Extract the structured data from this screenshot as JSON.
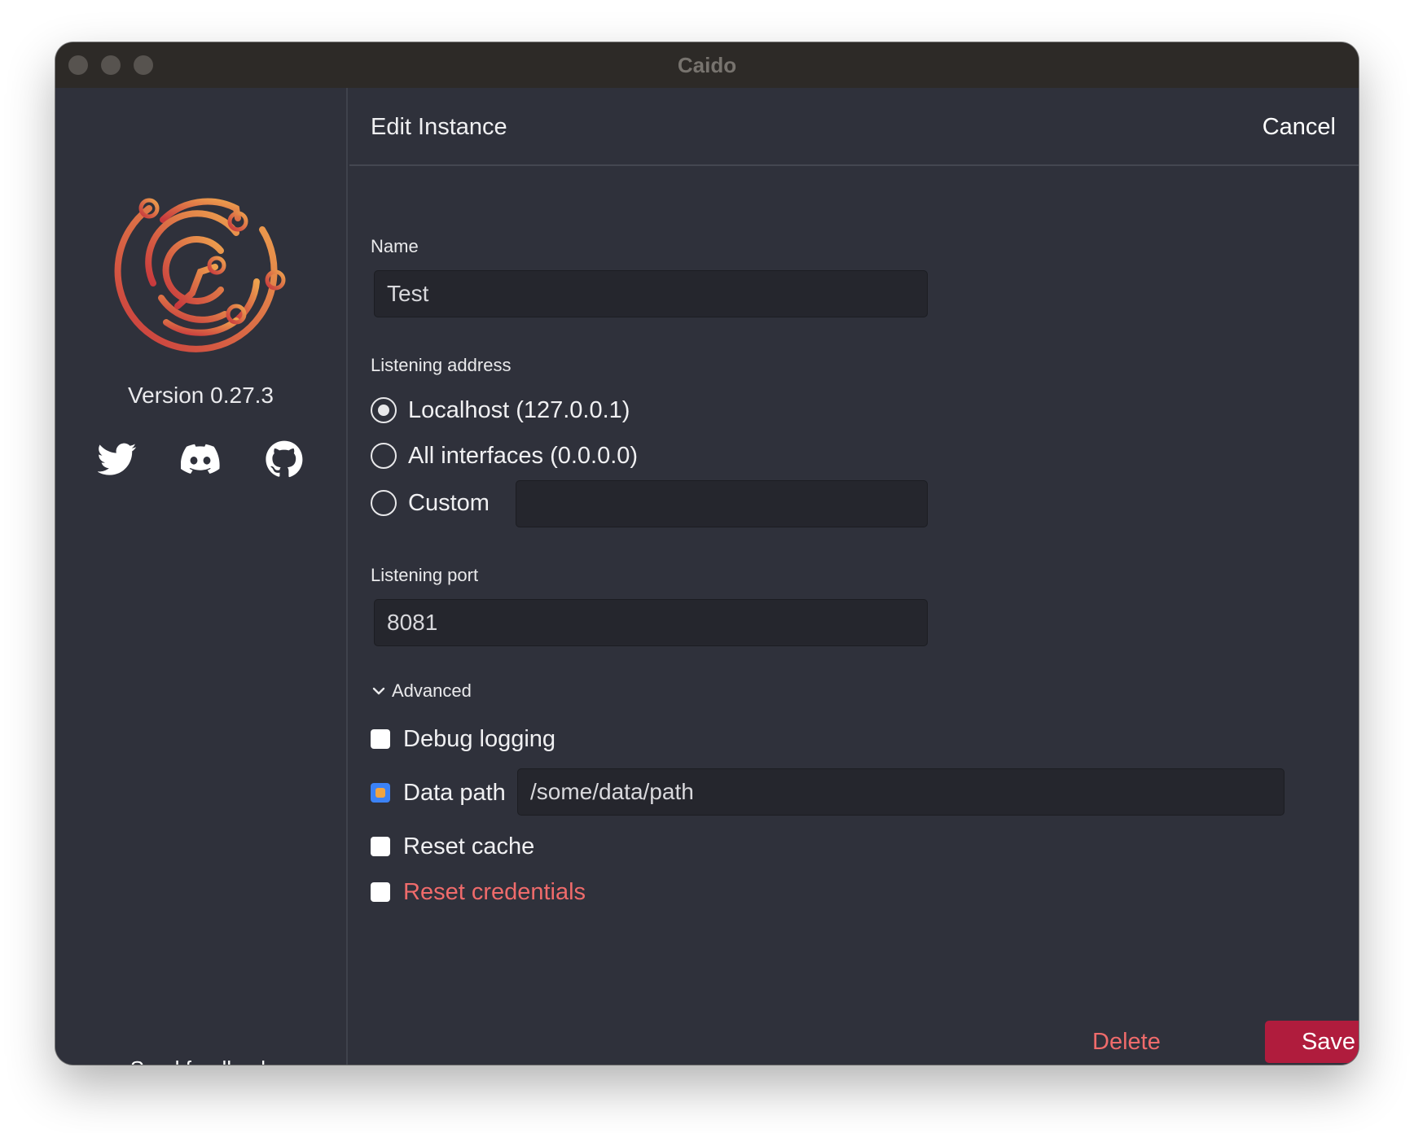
{
  "window": {
    "title": "Caido"
  },
  "sidebar": {
    "version": "Version 0.27.3",
    "social": [
      {
        "icon": "twitter-icon"
      },
      {
        "icon": "discord-icon"
      },
      {
        "icon": "github-icon"
      }
    ],
    "feedback_label": "Send feedback"
  },
  "header": {
    "title": "Edit Instance",
    "cancel_label": "Cancel"
  },
  "form": {
    "name": {
      "label": "Name",
      "value": "Test"
    },
    "listening_address": {
      "label": "Listening address",
      "selected": "localhost",
      "options": [
        {
          "id": "localhost",
          "label": "Localhost (127.0.0.1)"
        },
        {
          "id": "all",
          "label": "All interfaces (0.0.0.0)"
        },
        {
          "id": "custom",
          "label": "Custom",
          "value": ""
        }
      ]
    },
    "listening_port": {
      "label": "Listening port",
      "value": "8081"
    },
    "advanced": {
      "label": "Advanced",
      "expanded": true,
      "debug_logging": {
        "label": "Debug logging",
        "checked": false
      },
      "data_path": {
        "label": "Data path",
        "checked": true,
        "value": "/some/data/path"
      },
      "reset_cache": {
        "label": "Reset cache",
        "checked": false
      },
      "reset_credentials": {
        "label": "Reset credentials",
        "checked": false
      }
    }
  },
  "footer": {
    "delete_label": "Delete",
    "save_label": "Save"
  },
  "colors": {
    "accent": "#b01c3d",
    "danger": "#ef6b6b",
    "checkbox_checked": "#3b82f6",
    "background": "#2f313b"
  }
}
